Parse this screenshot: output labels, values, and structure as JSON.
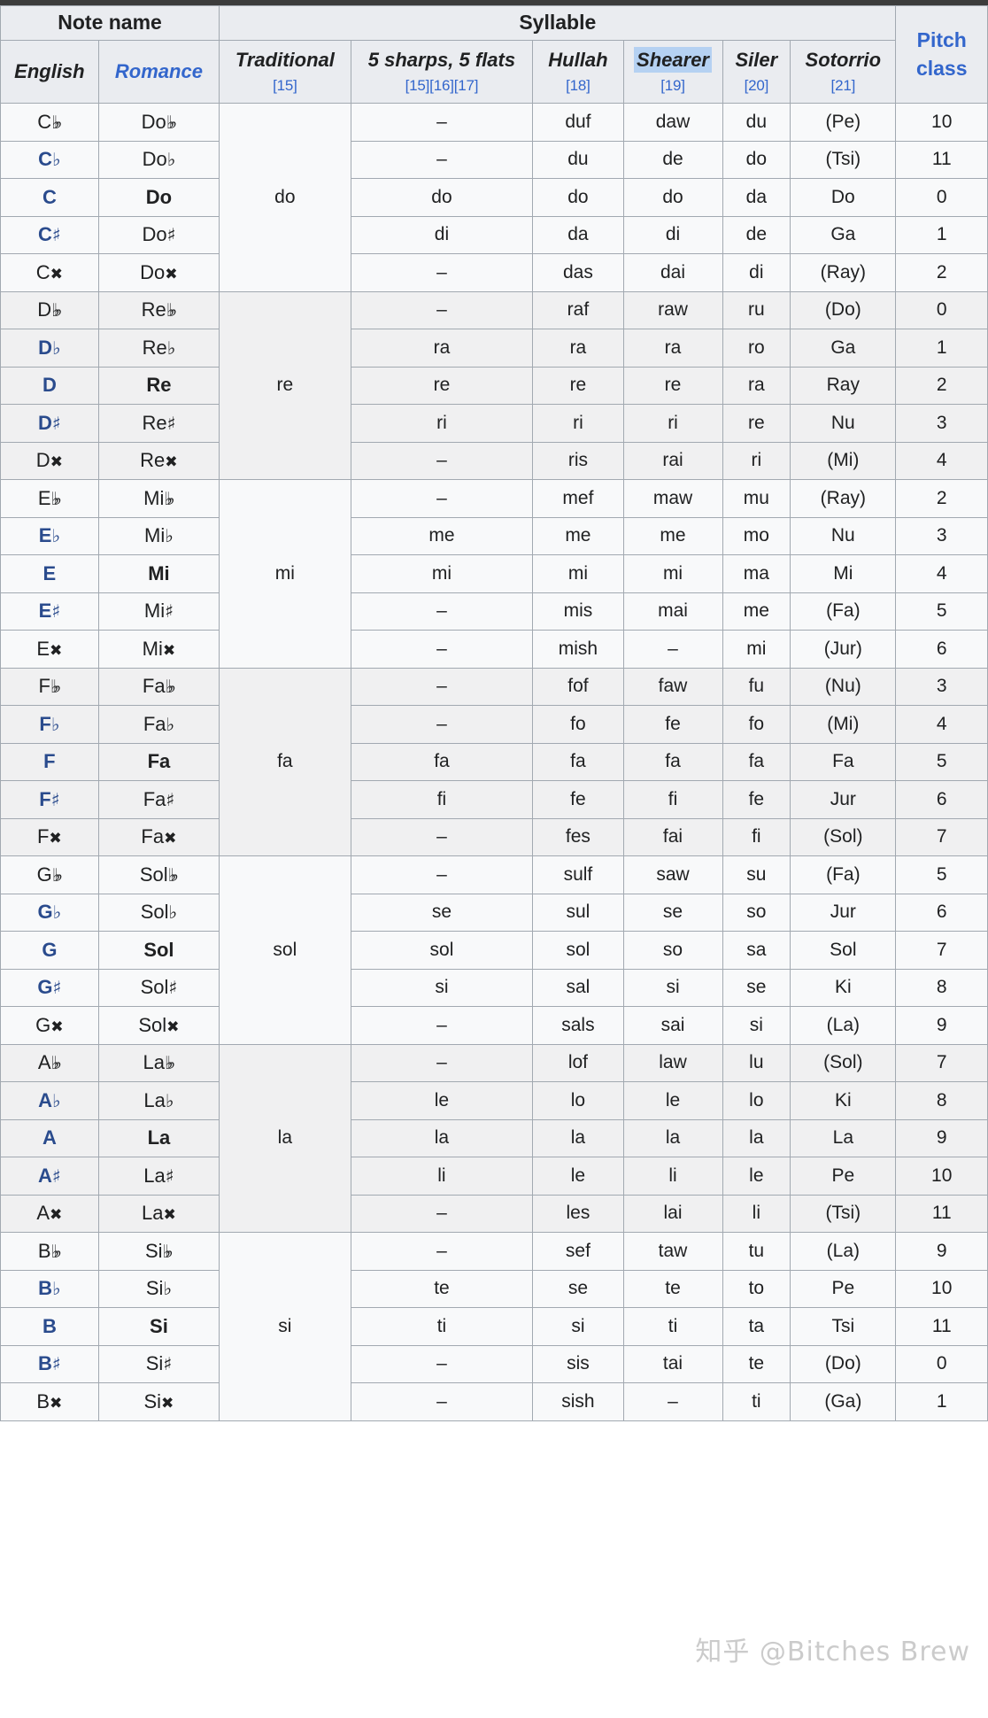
{
  "table": {
    "header": {
      "group_note_name": "Note name",
      "group_syllable": "Syllable",
      "pitch_class": "Pitch class",
      "pitch_class_line1": "Pitch",
      "pitch_class_line2": "class",
      "columns": [
        {
          "label": "English",
          "refs": ""
        },
        {
          "label": "Romance",
          "refs": ""
        },
        {
          "label": "Traditional",
          "refs": "[15]"
        },
        {
          "label": "5 sharps, 5 flats",
          "refs": "[15][16][17]"
        },
        {
          "label": "Hullah",
          "refs": "[18]"
        },
        {
          "label": "Shearer",
          "refs": "[19]",
          "highlighted": true
        },
        {
          "label": "Siler",
          "refs": "[20]"
        },
        {
          "label": "Sotorrio",
          "refs": "[21]"
        }
      ]
    },
    "groups": [
      {
        "traditional": "do",
        "shade": "a",
        "rows": [
          {
            "english": "C",
            "english_acc": "dflat",
            "romance": "Do",
            "romance_acc": "dflat",
            "style": "plain",
            "five": "–",
            "hullah": "duf",
            "shearer": "daw",
            "siler": "du",
            "sotorrio": "(Pe)",
            "pc": "10"
          },
          {
            "english": "C",
            "english_acc": "flat",
            "romance": "Do",
            "romance_acc": "flat",
            "style": "blue",
            "five": "–",
            "hullah": "du",
            "shearer": "de",
            "siler": "do",
            "sotorrio": "(Tsi)",
            "pc": "11"
          },
          {
            "english": "C",
            "english_acc": "",
            "romance": "Do",
            "romance_acc": "",
            "style": "natural",
            "five": "do",
            "hullah": "do",
            "shearer": "do",
            "siler": "da",
            "sotorrio": "Do",
            "pc": "0"
          },
          {
            "english": "C",
            "english_acc": "sharp",
            "romance": "Do",
            "romance_acc": "sharp",
            "style": "blue",
            "five": "di",
            "hullah": "da",
            "shearer": "di",
            "siler": "de",
            "sotorrio": "Ga",
            "pc": "1"
          },
          {
            "english": "C",
            "english_acc": "dsharp",
            "romance": "Do",
            "romance_acc": "dsharp",
            "style": "plain",
            "five": "–",
            "hullah": "das",
            "shearer": "dai",
            "siler": "di",
            "sotorrio": "(Ray)",
            "pc": "2"
          }
        ]
      },
      {
        "traditional": "re",
        "shade": "b",
        "rows": [
          {
            "english": "D",
            "english_acc": "dflat",
            "romance": "Re",
            "romance_acc": "dflat",
            "style": "plain",
            "five": "–",
            "hullah": "raf",
            "shearer": "raw",
            "siler": "ru",
            "sotorrio": "(Do)",
            "pc": "0"
          },
          {
            "english": "D",
            "english_acc": "flat",
            "romance": "Re",
            "romance_acc": "flat",
            "style": "blue",
            "five": "ra",
            "hullah": "ra",
            "shearer": "ra",
            "siler": "ro",
            "sotorrio": "Ga",
            "pc": "1"
          },
          {
            "english": "D",
            "english_acc": "",
            "romance": "Re",
            "romance_acc": "",
            "style": "natural",
            "five": "re",
            "hullah": "re",
            "shearer": "re",
            "siler": "ra",
            "sotorrio": "Ray",
            "pc": "2"
          },
          {
            "english": "D",
            "english_acc": "sharp",
            "romance": "Re",
            "romance_acc": "sharp",
            "style": "blue",
            "five": "ri",
            "hullah": "ri",
            "shearer": "ri",
            "siler": "re",
            "sotorrio": "Nu",
            "pc": "3"
          },
          {
            "english": "D",
            "english_acc": "dsharp",
            "romance": "Re",
            "romance_acc": "dsharp",
            "style": "plain",
            "five": "–",
            "hullah": "ris",
            "shearer": "rai",
            "siler": "ri",
            "sotorrio": "(Mi)",
            "pc": "4"
          }
        ]
      },
      {
        "traditional": "mi",
        "shade": "a",
        "rows": [
          {
            "english": "E",
            "english_acc": "dflat",
            "romance": "Mi",
            "romance_acc": "dflat",
            "style": "plain",
            "five": "–",
            "hullah": "mef",
            "shearer": "maw",
            "siler": "mu",
            "sotorrio": "(Ray)",
            "pc": "2"
          },
          {
            "english": "E",
            "english_acc": "flat",
            "romance": "Mi",
            "romance_acc": "flat",
            "style": "blue",
            "five": "me",
            "hullah": "me",
            "shearer": "me",
            "siler": "mo",
            "sotorrio": "Nu",
            "pc": "3"
          },
          {
            "english": "E",
            "english_acc": "",
            "romance": "Mi",
            "romance_acc": "",
            "style": "natural",
            "five": "mi",
            "hullah": "mi",
            "shearer": "mi",
            "siler": "ma",
            "sotorrio": "Mi",
            "pc": "4"
          },
          {
            "english": "E",
            "english_acc": "sharp",
            "romance": "Mi",
            "romance_acc": "sharp",
            "style": "blue",
            "five": "–",
            "hullah": "mis",
            "shearer": "mai",
            "siler": "me",
            "sotorrio": "(Fa)",
            "pc": "5"
          },
          {
            "english": "E",
            "english_acc": "dsharp",
            "romance": "Mi",
            "romance_acc": "dsharp",
            "style": "plain",
            "five": "–",
            "hullah": "mish",
            "shearer": "–",
            "siler": "mi",
            "sotorrio": "(Jur)",
            "pc": "6"
          }
        ]
      },
      {
        "traditional": "fa",
        "shade": "b",
        "rows": [
          {
            "english": "F",
            "english_acc": "dflat",
            "romance": "Fa",
            "romance_acc": "dflat",
            "style": "plain",
            "five": "–",
            "hullah": "fof",
            "shearer": "faw",
            "siler": "fu",
            "sotorrio": "(Nu)",
            "pc": "3"
          },
          {
            "english": "F",
            "english_acc": "flat",
            "romance": "Fa",
            "romance_acc": "flat",
            "style": "blue",
            "five": "–",
            "hullah": "fo",
            "shearer": "fe",
            "siler": "fo",
            "sotorrio": "(Mi)",
            "pc": "4"
          },
          {
            "english": "F",
            "english_acc": "",
            "romance": "Fa",
            "romance_acc": "",
            "style": "natural",
            "five": "fa",
            "hullah": "fa",
            "shearer": "fa",
            "siler": "fa",
            "sotorrio": "Fa",
            "pc": "5"
          },
          {
            "english": "F",
            "english_acc": "sharp",
            "romance": "Fa",
            "romance_acc": "sharp",
            "style": "blue",
            "five": "fi",
            "hullah": "fe",
            "shearer": "fi",
            "siler": "fe",
            "sotorrio": "Jur",
            "pc": "6"
          },
          {
            "english": "F",
            "english_acc": "dsharp",
            "romance": "Fa",
            "romance_acc": "dsharp",
            "style": "plain",
            "five": "–",
            "hullah": "fes",
            "shearer": "fai",
            "siler": "fi",
            "sotorrio": "(Sol)",
            "pc": "7"
          }
        ]
      },
      {
        "traditional": "sol",
        "shade": "a",
        "rows": [
          {
            "english": "G",
            "english_acc": "dflat",
            "romance": "Sol",
            "romance_acc": "dflat",
            "style": "plain",
            "five": "–",
            "hullah": "sulf",
            "shearer": "saw",
            "siler": "su",
            "sotorrio": "(Fa)",
            "pc": "5"
          },
          {
            "english": "G",
            "english_acc": "flat",
            "romance": "Sol",
            "romance_acc": "flat",
            "style": "blue",
            "five": "se",
            "hullah": "sul",
            "shearer": "se",
            "siler": "so",
            "sotorrio": "Jur",
            "pc": "6"
          },
          {
            "english": "G",
            "english_acc": "",
            "romance": "Sol",
            "romance_acc": "",
            "style": "natural",
            "five": "sol",
            "hullah": "sol",
            "shearer": "so",
            "siler": "sa",
            "sotorrio": "Sol",
            "pc": "7"
          },
          {
            "english": "G",
            "english_acc": "sharp",
            "romance": "Sol",
            "romance_acc": "sharp",
            "style": "blue",
            "five": "si",
            "hullah": "sal",
            "shearer": "si",
            "siler": "se",
            "sotorrio": "Ki",
            "pc": "8"
          },
          {
            "english": "G",
            "english_acc": "dsharp",
            "romance": "Sol",
            "romance_acc": "dsharp",
            "style": "plain",
            "five": "–",
            "hullah": "sals",
            "shearer": "sai",
            "siler": "si",
            "sotorrio": "(La)",
            "pc": "9"
          }
        ]
      },
      {
        "traditional": "la",
        "shade": "b",
        "rows": [
          {
            "english": "A",
            "english_acc": "dflat",
            "romance": "La",
            "romance_acc": "dflat",
            "style": "plain",
            "five": "–",
            "hullah": "lof",
            "shearer": "law",
            "siler": "lu",
            "sotorrio": "(Sol)",
            "pc": "7"
          },
          {
            "english": "A",
            "english_acc": "flat",
            "romance": "La",
            "romance_acc": "flat",
            "style": "blue",
            "five": "le",
            "hullah": "lo",
            "shearer": "le",
            "siler": "lo",
            "sotorrio": "Ki",
            "pc": "8"
          },
          {
            "english": "A",
            "english_acc": "",
            "romance": "La",
            "romance_acc": "",
            "style": "natural",
            "five": "la",
            "hullah": "la",
            "shearer": "la",
            "siler": "la",
            "sotorrio": "La",
            "pc": "9"
          },
          {
            "english": "A",
            "english_acc": "sharp",
            "romance": "La",
            "romance_acc": "sharp",
            "style": "blue",
            "five": "li",
            "hullah": "le",
            "shearer": "li",
            "siler": "le",
            "sotorrio": "Pe",
            "pc": "10"
          },
          {
            "english": "A",
            "english_acc": "dsharp",
            "romance": "La",
            "romance_acc": "dsharp",
            "style": "plain",
            "five": "–",
            "hullah": "les",
            "shearer": "lai",
            "siler": "li",
            "sotorrio": "(Tsi)",
            "pc": "11"
          }
        ]
      },
      {
        "traditional": "si",
        "shade": "a",
        "rows": [
          {
            "english": "B",
            "english_acc": "dflat",
            "romance": "Si",
            "romance_acc": "dflat",
            "style": "plain",
            "five": "–",
            "hullah": "sef",
            "shearer": "taw",
            "siler": "tu",
            "sotorrio": "(La)",
            "pc": "9"
          },
          {
            "english": "B",
            "english_acc": "flat",
            "romance": "Si",
            "romance_acc": "flat",
            "style": "blue",
            "five": "te",
            "hullah": "se",
            "shearer": "te",
            "siler": "to",
            "sotorrio": "Pe",
            "pc": "10"
          },
          {
            "english": "B",
            "english_acc": "",
            "romance": "Si",
            "romance_acc": "",
            "style": "natural",
            "five": "ti",
            "hullah": "si",
            "shearer": "ti",
            "siler": "ta",
            "sotorrio": "Tsi",
            "pc": "11"
          },
          {
            "english": "B",
            "english_acc": "sharp",
            "romance": "Si",
            "romance_acc": "sharp",
            "style": "blue",
            "five": "–",
            "hullah": "sis",
            "shearer": "tai",
            "siler": "te",
            "sotorrio": "(Do)",
            "pc": "0"
          },
          {
            "english": "B",
            "english_acc": "dsharp",
            "romance": "Si",
            "romance_acc": "dsharp",
            "style": "plain",
            "five": "–",
            "hullah": "sish",
            "shearer": "–",
            "siler": "ti",
            "sotorrio": "(Ga)",
            "pc": "1"
          }
        ]
      }
    ]
  },
  "watermark": "知乎 @Bitches Brew",
  "accidental_glyphs": {
    "flat": "♭",
    "dflat": "♭♭",
    "sharp": "♯",
    "dsharp": "✖"
  },
  "colors": {
    "link": "#3366cc",
    "note_blue": "#2a4b8d",
    "header_bg": "#eaecf0",
    "row_light": "#f8f9fa",
    "row_dark": "#f0f0f1",
    "border": "#a2a9b1",
    "highlight": "#b5d1f2"
  }
}
